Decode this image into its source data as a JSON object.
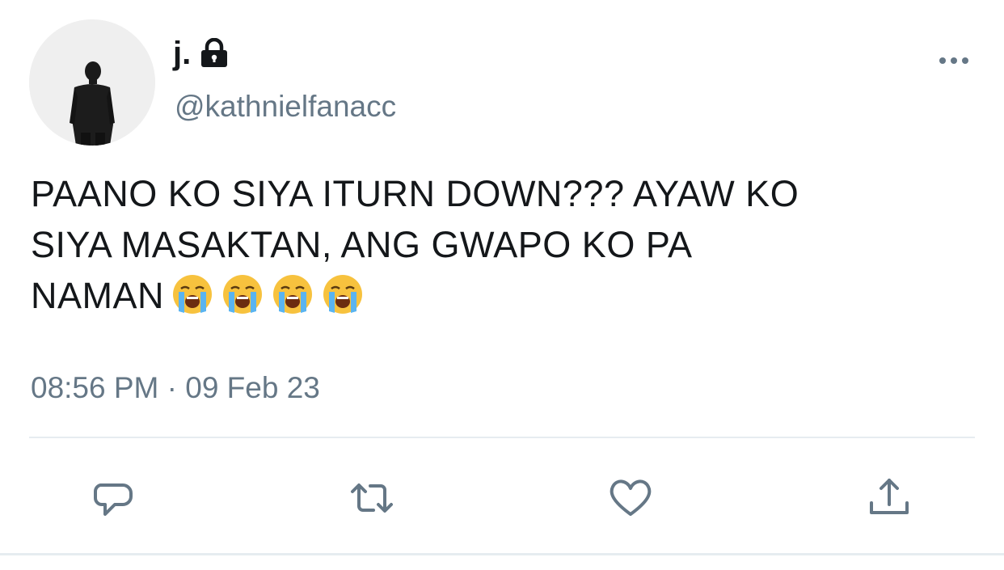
{
  "tweet": {
    "display_name": "j.",
    "handle": "@kathnielfanacc",
    "text_line1": "PAANO KO SIYA ITURN DOWN??? AYAW KO",
    "text_line2": "SIYA MASAKTAN, ANG GWAPO KO PA",
    "text_line3": "NAMAN",
    "emojis": [
      "loudly-crying-face",
      "loudly-crying-face",
      "loudly-crying-face",
      "loudly-crying-face"
    ],
    "timestamp": "08:56 PM · 09 Feb 23",
    "protected_account": true
  },
  "icons": {
    "avatar": "avatar-man-in-suit",
    "lock": "lock-icon",
    "more": "more-horizontal-icon",
    "reply": "reply-icon",
    "retweet": "retweet-icon",
    "like": "heart-icon",
    "share": "share-icon"
  },
  "colors": {
    "text": "#14171a",
    "secondary": "#657786",
    "action_icon": "#657786",
    "divider": "#e6ecf0"
  }
}
